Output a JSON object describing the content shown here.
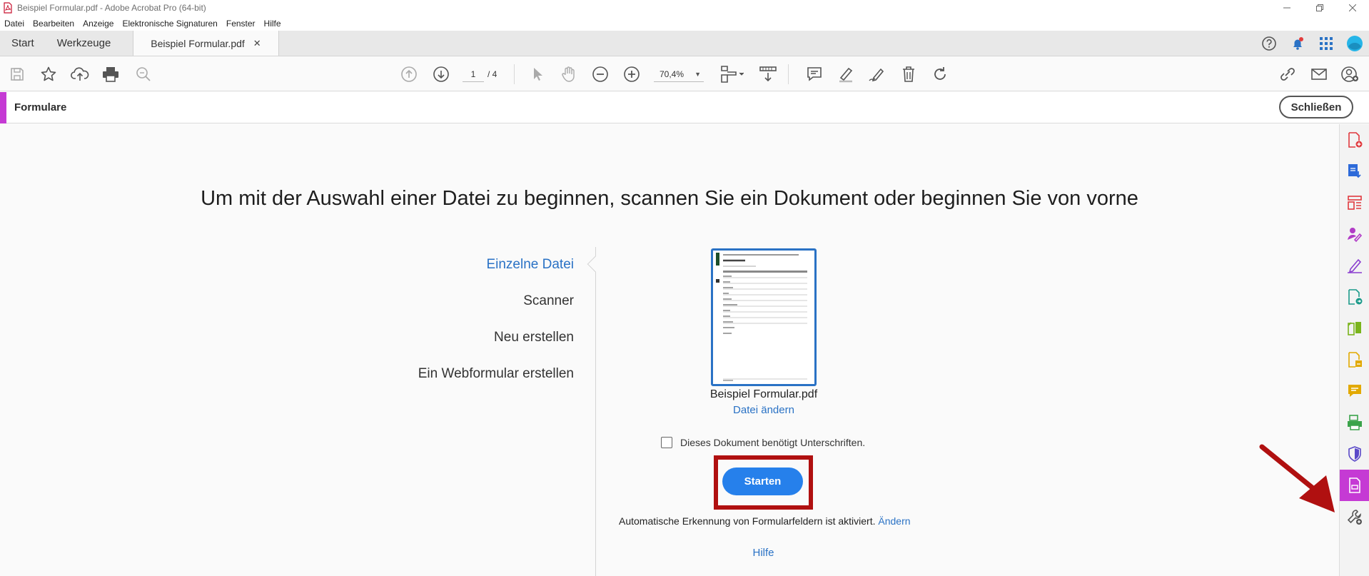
{
  "window": {
    "title": "Beispiel Formular.pdf - Adobe Acrobat Pro (64-bit)"
  },
  "menu": [
    "Datei",
    "Bearbeiten",
    "Anzeige",
    "Elektronische Signaturen",
    "Fenster",
    "Hilfe"
  ],
  "tabs": {
    "start": "Start",
    "tools": "Werkzeuge",
    "document": "Beispiel Formular.pdf",
    "close_glyph": "✕"
  },
  "toolbar": {
    "page_current": "1",
    "page_total": "/ 4",
    "zoom": "70,4%"
  },
  "tool_header": {
    "title": "Formulare",
    "close_label": "Schließen",
    "accent_color": "#c53ad4"
  },
  "main": {
    "heading": "Um mit der Auswahl einer Datei zu beginnen, scannen Sie ein Dokument oder beginnen Sie von vorne",
    "options": [
      {
        "label": "Einzelne Datei",
        "active": true
      },
      {
        "label": "Scanner",
        "active": false
      },
      {
        "label": "Neu erstellen",
        "active": false
      },
      {
        "label": "Ein Webformular erstellen",
        "active": false
      }
    ],
    "file_name": "Beispiel Formular.pdf",
    "change_file": "Datei ändern",
    "signature_checkbox": "Dieses Dokument benötigt Unterschriften.",
    "start_button": "Starten",
    "auto_detect_text": "Automatische Erkennung von Formularfeldern ist aktiviert.",
    "auto_detect_link": "Ändern",
    "help_link": "Hilfe"
  },
  "rail_icons": [
    "create-pdf-icon",
    "export-pdf-icon",
    "organize-pages-icon",
    "fill-sign-icon",
    "request-signatures-icon",
    "send-for-review-icon",
    "compare-files-icon",
    "edit-pdf-icon",
    "comment-icon",
    "scan-ocr-icon",
    "protect-icon",
    "prepare-form-icon",
    "more-tools-icon"
  ],
  "colors": {
    "accent_blue": "#2680eb",
    "link_blue": "#2a72c5",
    "highlight_red": "#b01010",
    "forms_purple": "#c53ad4"
  }
}
